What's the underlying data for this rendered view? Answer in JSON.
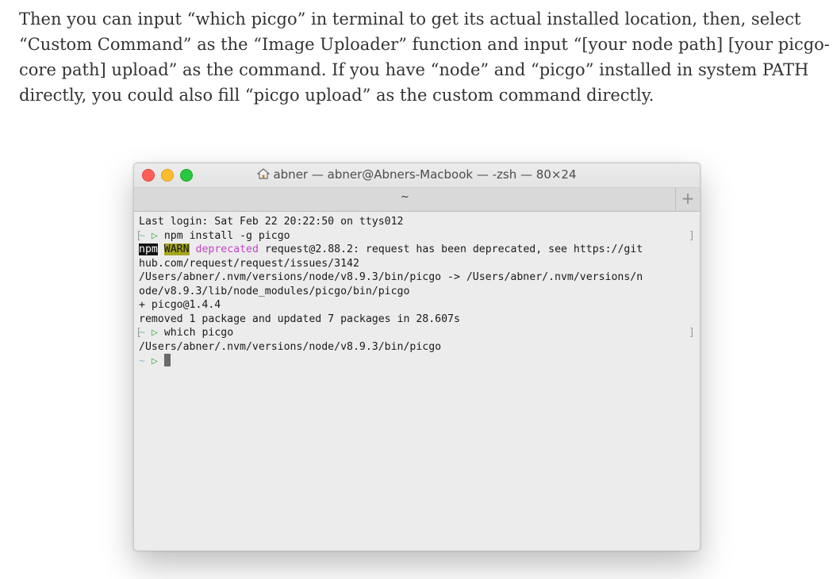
{
  "article": {
    "lines": [
      "Then you can input “which picgo” in terminal to get its actual installed location, then, select",
      "“Custom Command” as the “Image Uploader” function and input “[your node path] [your picgo-",
      "core path] upload” as the command. If you have “node” and “picgo” installed in system PATH",
      "directly, you could also fill “picgo upload” as the custom command directly."
    ]
  },
  "window": {
    "title": "abner — abner@Abners-Macbook — -zsh — 80×24",
    "tab_label": "~",
    "new_tab_label": "+",
    "icons": {
      "title": "home-icon",
      "close": "close-button",
      "minimize": "minimize-button",
      "maximize": "maximize-button"
    }
  },
  "terminal": {
    "last_login": "Last login: Sat Feb 22 20:22:50 on ttys012",
    "prompt_tilde": "~",
    "prompt_arrow": "▷",
    "cmd1": "npm install -g picgo",
    "npm_label": "npm",
    "warn_label": "WARN",
    "deprecated_label": "deprecated",
    "warn_msg": " request@2.88.2: request has been deprecated, see https://git",
    "warn_msg_cont": "hub.com/request/request/issues/3142",
    "link_line1": "/Users/abner/.nvm/versions/node/v8.9.3/bin/picgo -> /Users/abner/.nvm/versions/n",
    "link_line2": "ode/v8.9.3/lib/node_modules/picgo/bin/picgo",
    "installed": "+ picgo@1.4.4",
    "summary": "removed 1 package and updated 7 packages in 28.607s",
    "cmd2": "which picgo",
    "which_output": "/Users/abner/.nvm/versions/node/v8.9.3/bin/picgo",
    "bracket_open": "[",
    "bracket_close": "]"
  },
  "colors": {
    "close": "#ff5f57",
    "minimize": "#febc2e",
    "maximize": "#28c840",
    "prompt_arrow": "#3fae3f",
    "deprecated": "#c445c4",
    "warn_bg": "#a6a61e"
  }
}
